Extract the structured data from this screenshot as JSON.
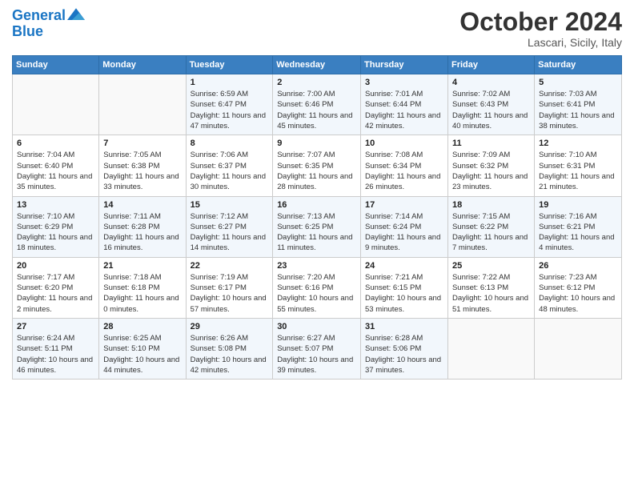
{
  "header": {
    "logo_line1": "General",
    "logo_line2": "Blue",
    "month_title": "October 2024",
    "location": "Lascari, Sicily, Italy"
  },
  "weekdays": [
    "Sunday",
    "Monday",
    "Tuesday",
    "Wednesday",
    "Thursday",
    "Friday",
    "Saturday"
  ],
  "weeks": [
    [
      {
        "day": "",
        "detail": ""
      },
      {
        "day": "",
        "detail": ""
      },
      {
        "day": "1",
        "detail": "Sunrise: 6:59 AM\nSunset: 6:47 PM\nDaylight: 11 hours and 47 minutes."
      },
      {
        "day": "2",
        "detail": "Sunrise: 7:00 AM\nSunset: 6:46 PM\nDaylight: 11 hours and 45 minutes."
      },
      {
        "day": "3",
        "detail": "Sunrise: 7:01 AM\nSunset: 6:44 PM\nDaylight: 11 hours and 42 minutes."
      },
      {
        "day": "4",
        "detail": "Sunrise: 7:02 AM\nSunset: 6:43 PM\nDaylight: 11 hours and 40 minutes."
      },
      {
        "day": "5",
        "detail": "Sunrise: 7:03 AM\nSunset: 6:41 PM\nDaylight: 11 hours and 38 minutes."
      }
    ],
    [
      {
        "day": "6",
        "detail": "Sunrise: 7:04 AM\nSunset: 6:40 PM\nDaylight: 11 hours and 35 minutes."
      },
      {
        "day": "7",
        "detail": "Sunrise: 7:05 AM\nSunset: 6:38 PM\nDaylight: 11 hours and 33 minutes."
      },
      {
        "day": "8",
        "detail": "Sunrise: 7:06 AM\nSunset: 6:37 PM\nDaylight: 11 hours and 30 minutes."
      },
      {
        "day": "9",
        "detail": "Sunrise: 7:07 AM\nSunset: 6:35 PM\nDaylight: 11 hours and 28 minutes."
      },
      {
        "day": "10",
        "detail": "Sunrise: 7:08 AM\nSunset: 6:34 PM\nDaylight: 11 hours and 26 minutes."
      },
      {
        "day": "11",
        "detail": "Sunrise: 7:09 AM\nSunset: 6:32 PM\nDaylight: 11 hours and 23 minutes."
      },
      {
        "day": "12",
        "detail": "Sunrise: 7:10 AM\nSunset: 6:31 PM\nDaylight: 11 hours and 21 minutes."
      }
    ],
    [
      {
        "day": "13",
        "detail": "Sunrise: 7:10 AM\nSunset: 6:29 PM\nDaylight: 11 hours and 18 minutes."
      },
      {
        "day": "14",
        "detail": "Sunrise: 7:11 AM\nSunset: 6:28 PM\nDaylight: 11 hours and 16 minutes."
      },
      {
        "day": "15",
        "detail": "Sunrise: 7:12 AM\nSunset: 6:27 PM\nDaylight: 11 hours and 14 minutes."
      },
      {
        "day": "16",
        "detail": "Sunrise: 7:13 AM\nSunset: 6:25 PM\nDaylight: 11 hours and 11 minutes."
      },
      {
        "day": "17",
        "detail": "Sunrise: 7:14 AM\nSunset: 6:24 PM\nDaylight: 11 hours and 9 minutes."
      },
      {
        "day": "18",
        "detail": "Sunrise: 7:15 AM\nSunset: 6:22 PM\nDaylight: 11 hours and 7 minutes."
      },
      {
        "day": "19",
        "detail": "Sunrise: 7:16 AM\nSunset: 6:21 PM\nDaylight: 11 hours and 4 minutes."
      }
    ],
    [
      {
        "day": "20",
        "detail": "Sunrise: 7:17 AM\nSunset: 6:20 PM\nDaylight: 11 hours and 2 minutes."
      },
      {
        "day": "21",
        "detail": "Sunrise: 7:18 AM\nSunset: 6:18 PM\nDaylight: 11 hours and 0 minutes."
      },
      {
        "day": "22",
        "detail": "Sunrise: 7:19 AM\nSunset: 6:17 PM\nDaylight: 10 hours and 57 minutes."
      },
      {
        "day": "23",
        "detail": "Sunrise: 7:20 AM\nSunset: 6:16 PM\nDaylight: 10 hours and 55 minutes."
      },
      {
        "day": "24",
        "detail": "Sunrise: 7:21 AM\nSunset: 6:15 PM\nDaylight: 10 hours and 53 minutes."
      },
      {
        "day": "25",
        "detail": "Sunrise: 7:22 AM\nSunset: 6:13 PM\nDaylight: 10 hours and 51 minutes."
      },
      {
        "day": "26",
        "detail": "Sunrise: 7:23 AM\nSunset: 6:12 PM\nDaylight: 10 hours and 48 minutes."
      }
    ],
    [
      {
        "day": "27",
        "detail": "Sunrise: 6:24 AM\nSunset: 5:11 PM\nDaylight: 10 hours and 46 minutes."
      },
      {
        "day": "28",
        "detail": "Sunrise: 6:25 AM\nSunset: 5:10 PM\nDaylight: 10 hours and 44 minutes."
      },
      {
        "day": "29",
        "detail": "Sunrise: 6:26 AM\nSunset: 5:08 PM\nDaylight: 10 hours and 42 minutes."
      },
      {
        "day": "30",
        "detail": "Sunrise: 6:27 AM\nSunset: 5:07 PM\nDaylight: 10 hours and 39 minutes."
      },
      {
        "day": "31",
        "detail": "Sunrise: 6:28 AM\nSunset: 5:06 PM\nDaylight: 10 hours and 37 minutes."
      },
      {
        "day": "",
        "detail": ""
      },
      {
        "day": "",
        "detail": ""
      }
    ]
  ]
}
